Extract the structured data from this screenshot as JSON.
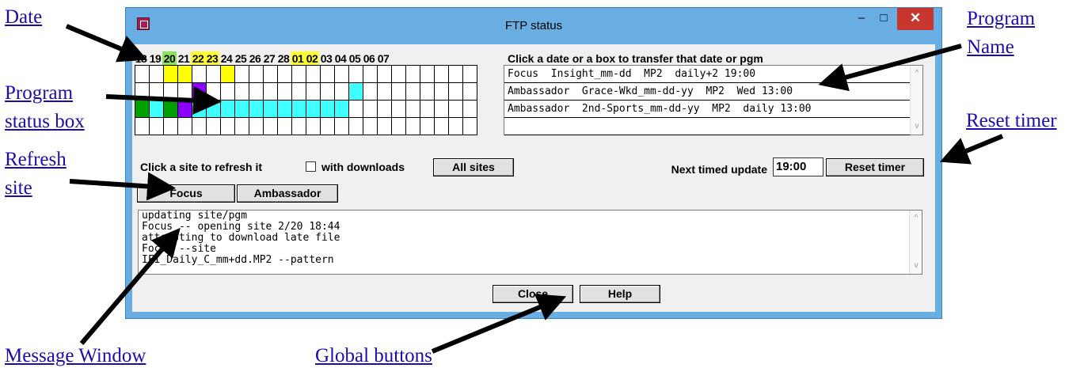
{
  "window": {
    "title": "FTP status",
    "minimize_glyph": "–",
    "maximize_glyph": "□",
    "close_glyph": "✕"
  },
  "dates": {
    "items": [
      {
        "label": "18",
        "color": "none"
      },
      {
        "label": "19",
        "color": "none"
      },
      {
        "label": "20",
        "color": "#8de35f"
      },
      {
        "label": "21",
        "color": "none"
      },
      {
        "label": "22",
        "color": "#ffff33"
      },
      {
        "label": "23",
        "color": "#ffff33"
      },
      {
        "label": "24",
        "color": "none"
      },
      {
        "label": "25",
        "color": "none"
      },
      {
        "label": "26",
        "color": "none"
      },
      {
        "label": "27",
        "color": "none"
      },
      {
        "label": "28",
        "color": "none"
      },
      {
        "label": "01",
        "color": "#ffff33"
      },
      {
        "label": "02",
        "color": "#ffff33"
      },
      {
        "label": "03",
        "color": "none"
      },
      {
        "label": "04",
        "color": "none"
      },
      {
        "label": "05",
        "color": "none"
      },
      {
        "label": "06",
        "color": "none"
      },
      {
        "label": "07",
        "color": "none"
      }
    ],
    "instruction": "Click a date or a box to transfer that date or pgm"
  },
  "status_grid": {
    "columns": 24,
    "rows": [
      [
        "",
        "",
        "yellow",
        "yellow",
        "",
        "",
        "yellow",
        "",
        "",
        "",
        "",
        "",
        "",
        "",
        "",
        "",
        "",
        "",
        "",
        "",
        "",
        "",
        "",
        ""
      ],
      [
        "",
        "",
        "",
        "",
        "purple",
        "",
        "",
        "",
        "",
        "",
        "",
        "",
        "",
        "",
        "",
        "cyan",
        "",
        "",
        "",
        "",
        "",
        "",
        "",
        ""
      ],
      [
        "green",
        "cyan",
        "green",
        "purple",
        "cyan",
        "cyan",
        "cyan",
        "cyan",
        "cyan",
        "cyan",
        "cyan",
        "cyan",
        "cyan",
        "cyan",
        "cyan",
        "",
        "",
        "",
        "",
        "",
        "",
        "",
        "",
        ""
      ],
      [
        "",
        "",
        "",
        "",
        "",
        "",
        "",
        "",
        "",
        "",
        "",
        "",
        "",
        "",
        "",
        "",
        "",
        "",
        "",
        "",
        "",
        "",
        "",
        ""
      ]
    ],
    "colors": {
      "yellow": "#ffff00",
      "purple": "#8b00ff",
      "cyan": "#40ffff",
      "green": "#00a000"
    }
  },
  "programs": [
    "Focus  Insight_mm-dd  MP2  daily+2 19:00",
    "Ambassador  Grace-Wkd_mm-dd-yy  MP2  Wed 13:00",
    "Ambassador  2nd-Sports_mm-dd-yy  MP2  daily 13:00",
    ""
  ],
  "refresh": {
    "label": "Click a site to refresh it",
    "checkbox_label": "with downloads",
    "all_sites_button": "All sites",
    "sites": [
      "Focus",
      "Ambassador"
    ]
  },
  "timer": {
    "label": "Next timed update",
    "value": "19:00",
    "reset_button": "Reset timer"
  },
  "messages": [
    "updating site/pgm",
    "Focus -- opening site 2/20 18:44",
    "attempting to download late file",
    "Focus --site",
    "IFI_Daily_C_mm+dd.MP2 --pattern"
  ],
  "global_buttons": {
    "close": "Close",
    "help": "Help"
  },
  "scroll_glyphs": {
    "up": "^",
    "down": "v"
  },
  "callouts": {
    "date": "Date",
    "program_name_1": "Program",
    "program_name_2": "Name",
    "program_status_box_1": "Program",
    "program_status_box_2": "status box",
    "reset_timer": "Reset timer",
    "refresh_site_1": "Refresh",
    "refresh_site_2": "site",
    "message_window": "Message Window",
    "global_buttons": "Global buttons"
  }
}
